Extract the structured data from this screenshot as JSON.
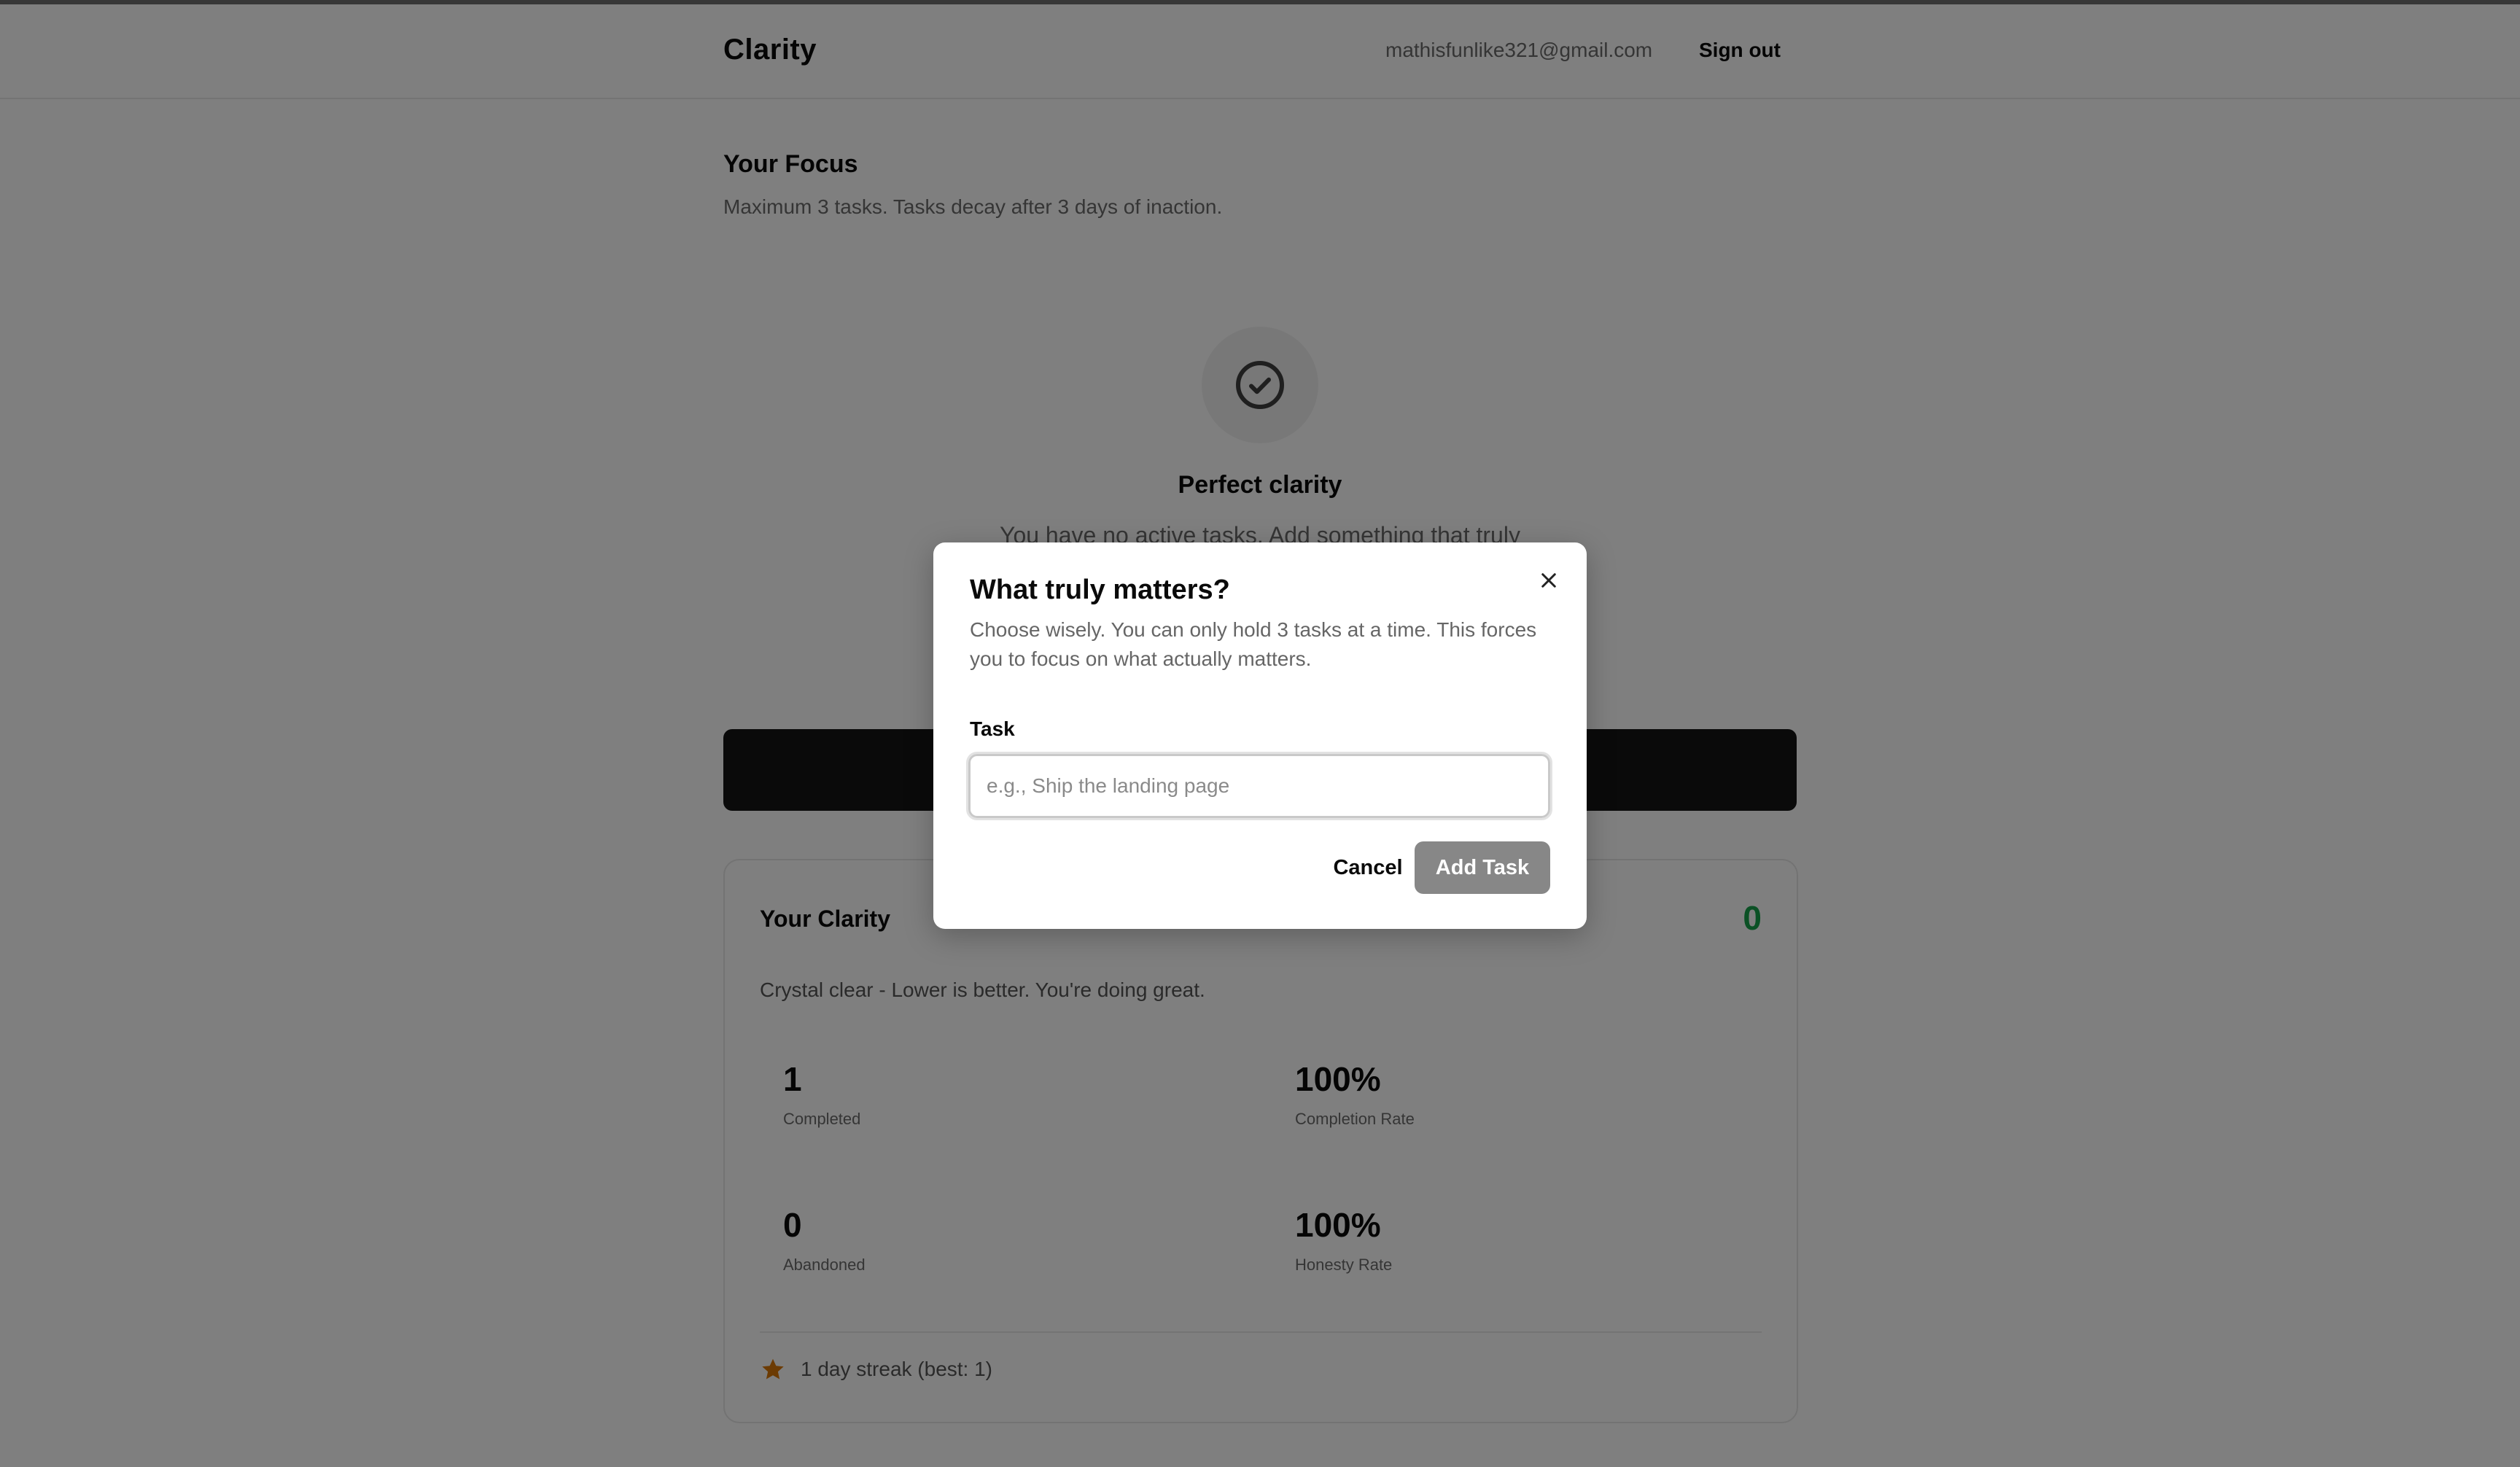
{
  "app": {
    "name": "Clarity",
    "user_email": "mathisfunlike321@gmail.com",
    "sign_out_label": "Sign out"
  },
  "focus": {
    "title": "Your Focus",
    "subtitle": "Maximum 3 tasks. Tasks decay after 3 days of inaction.",
    "empty_title": "Perfect clarity",
    "empty_subtitle": "You have no active tasks. Add something that truly"
  },
  "clarity_card": {
    "title": "Your Clarity",
    "score": "0",
    "description": "Crystal clear - Lower is better. You're doing great.",
    "stats": [
      {
        "value": "1",
        "label": "Completed"
      },
      {
        "value": "100%",
        "label": "Completion Rate"
      },
      {
        "value": "0",
        "label": "Abandoned"
      },
      {
        "value": "100%",
        "label": "Honesty Rate"
      }
    ],
    "streak_text": "1 day streak (best: 1)"
  },
  "modal": {
    "title": "What truly matters?",
    "description": "Choose wisely. You can only hold 3 tasks at a time. This forces you to focus on what actually matters.",
    "field_label": "Task",
    "input_value": "",
    "input_placeholder": "e.g., Ship the landing page",
    "cancel_label": "Cancel",
    "submit_label": "Add Task"
  },
  "colors": {
    "score_green": "#16a34a",
    "streak_star": "#d97706",
    "primary_dark": "#141414",
    "overlay": "rgba(0,0,0,0.5)"
  },
  "icons": {
    "empty_state": "check-circle-icon",
    "streak": "star-icon",
    "close": "close-icon"
  }
}
